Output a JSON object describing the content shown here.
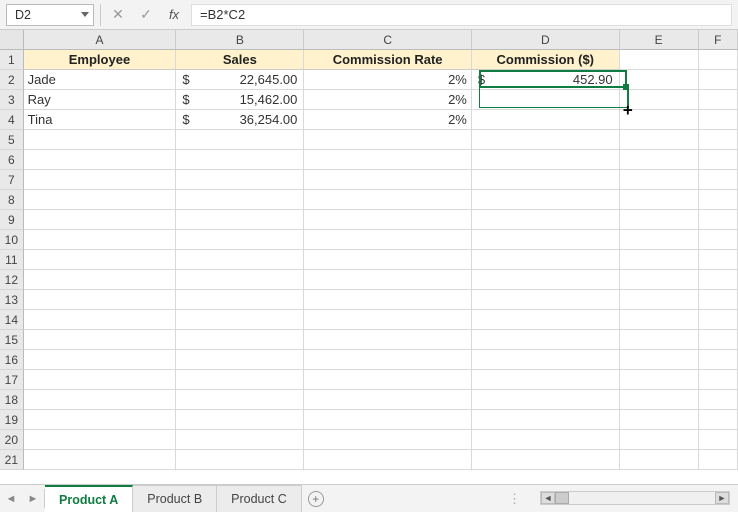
{
  "formula_bar": {
    "name_box": "D2",
    "formula": "=B2*C2",
    "cancel_glyph": "✕",
    "enter_glyph": "✓",
    "fx_label": "fx"
  },
  "columns": [
    "A",
    "B",
    "C",
    "D",
    "E",
    "F"
  ],
  "headers": {
    "A": "Employee",
    "B": "Sales",
    "C": "Commission Rate",
    "D": "Commission ($)"
  },
  "data_rows": [
    {
      "employee": "Jade",
      "sales_symbol": "$",
      "sales": "22,645.00",
      "rate": "2%",
      "commission_symbol": "$",
      "commission": "452.90"
    },
    {
      "employee": "Ray",
      "sales_symbol": "$",
      "sales": "15,462.00",
      "rate": "2%",
      "commission_symbol": "",
      "commission": ""
    },
    {
      "employee": "Tina",
      "sales_symbol": "$",
      "sales": "36,254.00",
      "rate": "2%",
      "commission_symbol": "",
      "commission": ""
    }
  ],
  "sheet_tabs": [
    "Product A",
    "Product B",
    "Product C"
  ],
  "active_tab_index": 0,
  "add_sheet_glyph": "+",
  "active_cell": "D2",
  "total_rows_visible": 21
}
